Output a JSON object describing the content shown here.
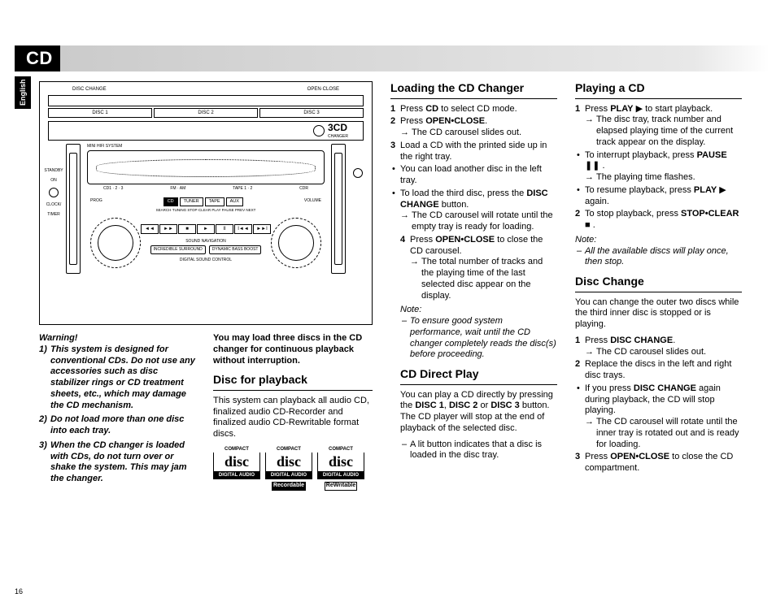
{
  "letterhead": "CD",
  "lang_tab": "English",
  "page_number": "16",
  "illustration": {
    "top_left": "DISC CHANGE",
    "top_right": "OPEN·CLOSE",
    "disc_buttons": [
      "DISC 1",
      "DISC 2",
      "DISC 3"
    ],
    "cd3_label": "3CD",
    "cd3_sub": "CHANGER",
    "side_labels": {
      "hifi": "MINI HIFI SYSTEM",
      "standby": "STANDBY",
      "on": "ON",
      "clock": "CLOCK/",
      "timer": "TIMER"
    },
    "src_row_label_left": "CD1 · 2 · 3",
    "src_row_label_mid": "FM · AM",
    "src_row_label_right": "TAPE 1 · 2",
    "src_row_label_far": "CDR",
    "sources": [
      "CD",
      "TUNER",
      "TAPE",
      "AUX"
    ],
    "prog": "PROG",
    "volume": "VOLUME",
    "btn_labels": "SEARCH·TUNING   STOP·CLEAR   PLAY  PAUSE   PREV    NEXT",
    "transport": [
      "◄◄",
      "►►",
      "■",
      "►",
      "II",
      "I◄◄",
      "►►I"
    ],
    "nav_title": "SOUND NAVIGATION",
    "nav_btns": [
      "INCREDIBLE SURROUND",
      "DYNAMIC BASS BOOST"
    ],
    "dsc": "DIGITAL SOUND CONTROL"
  },
  "warning": {
    "title": "Warning!",
    "items": [
      "This system is designed for conventional CDs. Do not use any accessories such as disc stabilizer rings or CD treatment sheets, etc., which may damage the CD mechanism.",
      "Do not load more than one disc into each tray.",
      "When the CD changer is loaded with CDs, do not turn over or shake the system. This may jam the changer."
    ]
  },
  "load_intro": "You may load three discs in the CD changer for continuous playback without interruption.",
  "disc_playback": {
    "title": "Disc for playback",
    "body": "This system can playback all audio CD, finalized audio CD-Recorder and finalized audio CD-Rewritable format discs.",
    "logos": [
      {
        "compact": "COMPACT",
        "disc": "disc",
        "da": "DIGITAL AUDIO",
        "sub": ""
      },
      {
        "compact": "COMPACT",
        "disc": "disc",
        "da": "DIGITAL AUDIO",
        "sub": "Recordable"
      },
      {
        "compact": "COMPACT",
        "disc": "disc",
        "da": "DIGITAL AUDIO",
        "sub": "ReWritable"
      }
    ]
  },
  "loading": {
    "title": "Loading the CD Changer",
    "s1a": "Press ",
    "s1b": "CD",
    "s1c": " to select CD mode.",
    "s2a": "Press ",
    "s2b": "OPEN•CLOSE",
    "s2c": ".",
    "s2_arrow": "The CD carousel slides out.",
    "s3": "Load a CD with the printed side up in the right tray.",
    "b1": "You can load another disc in the left tray.",
    "b2a": "To load the third disc, press the ",
    "b2b": "DISC CHANGE",
    "b2c": " button.",
    "b2_arrow": "The CD carousel will rotate until the empty tray is ready for loading.",
    "s4a": "Press ",
    "s4b": "OPEN•CLOSE",
    "s4c": " to close the CD carousel.",
    "s4_arrow": "The total number of tracks and the playing time of the last selected disc appear on the display.",
    "note_label": "Note:",
    "note_body": "To ensure good system performance, wait until the CD changer completely reads the disc(s) before proceeding."
  },
  "direct": {
    "title": "CD Direct Play",
    "p1a": "You can play a CD directly by pressing the ",
    "p1b": "DISC 1",
    "p1c": ", ",
    "p1d": "DISC 2",
    "p1e": " or ",
    "p1f": "DISC 3",
    "p1g": " button. The CD player will stop at the end of playback of the selected disc.",
    "d1": "A lit button indicates that a disc is loaded in the disc tray."
  },
  "playing": {
    "title": "Playing a CD",
    "s1a": "Press ",
    "s1b": "PLAY",
    "s1c": "  ▶  to start playback.",
    "s1_arrow": "The disc tray, track number and elapsed playing time of the current track appear on the display.",
    "b1a": "To interrupt playback, press ",
    "b1b": "PAUSE",
    "b1c": "  ❚❚ .",
    "b1_arrow": "The playing time flashes.",
    "b2a": "To resume playback, press ",
    "b2b": "PLAY",
    "b2c": "  ▶ again.",
    "s2a": "To stop playback, press ",
    "s2b": "STOP•CLEAR",
    "s2c": " ■ .",
    "note_label": "Note:",
    "note_body": "All the available discs will play once, then stop."
  },
  "change": {
    "title": "Disc Change",
    "intro": "You can change the outer two discs while the third inner disc is stopped or is playing.",
    "s1a": "Press ",
    "s1b": "DISC CHANGE",
    "s1c": ".",
    "s1_arrow": "The CD carousel slides out.",
    "s2": "Replace the discs in the left and right disc trays.",
    "b1a": "If you press ",
    "b1b": "DISC CHANGE",
    "b1c": " again during playback, the CD will stop playing.",
    "b1_arrow": "The CD carousel will rotate until the inner tray is rotated out and is ready for loading.",
    "s3a": "Press ",
    "s3b": "OPEN•CLOSE",
    "s3c": " to close the CD compartment."
  }
}
